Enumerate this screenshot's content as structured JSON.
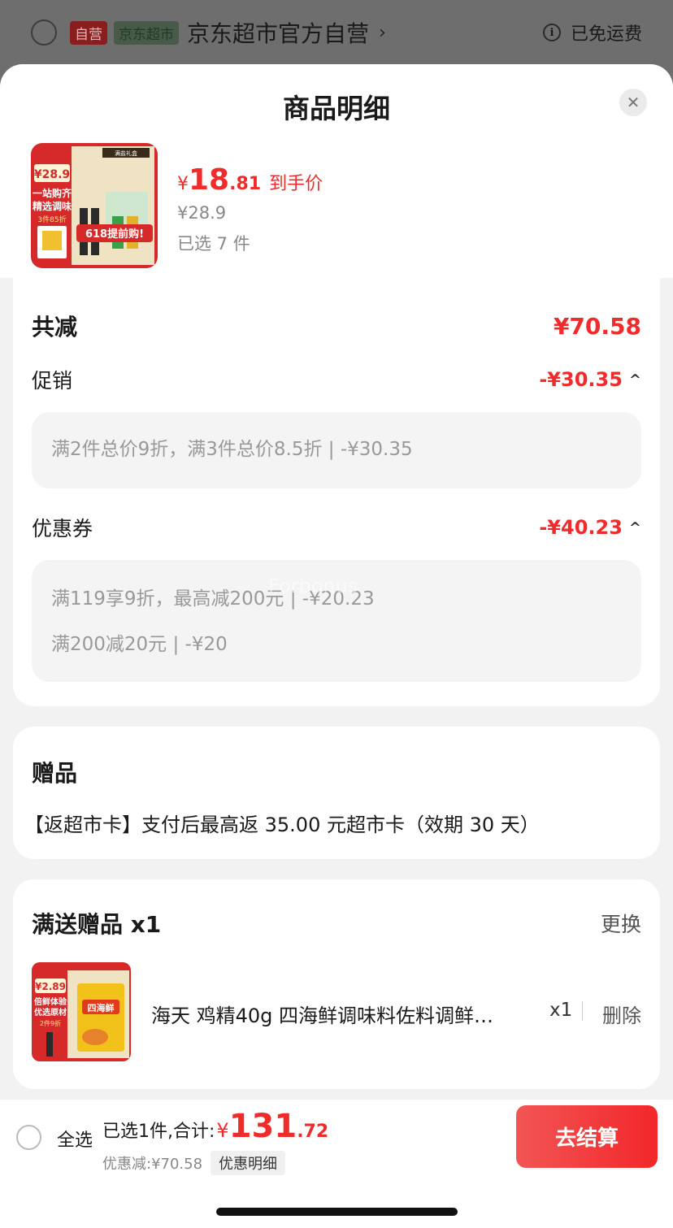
{
  "background_header": {
    "self_badge": "自营",
    "market_badge": "京东超市",
    "shop_name": "京东超市官方自营",
    "chevron": "›",
    "info_icon": "i",
    "shipping": "已免运费"
  },
  "sheet": {
    "title": "商品明细",
    "close_icon": "✕"
  },
  "product": {
    "price_symbol": "¥",
    "price_integer": "18",
    "price_decimal": ".81",
    "price_tag": "到手价",
    "original_price": "¥28.9",
    "selected_count": "已选 7 件",
    "image": {
      "top_price": "¥28.9",
      "slogan_1": "一站购齐",
      "slogan_2": "精选调味",
      "promo": "3件85折",
      "banner": "618提前购!",
      "corner_tag": "满盐礼盒"
    }
  },
  "discount": {
    "total_label": "共减",
    "total_value": "¥70.58",
    "promotion_label": "促销",
    "promotion_value": "-¥30.35",
    "promotion_details": [
      "满2件总价9折，满3件总价8.5折 | -¥30.35"
    ],
    "coupon_label": "优惠券",
    "coupon_value": "-¥40.23",
    "coupon_details": [
      "满119享9折，最高减200元 | -¥20.23",
      "满200减20元 | -¥20"
    ],
    "chevron_up": "^"
  },
  "gift": {
    "title": "赠品",
    "description": "【返超市卡】支付后最高返 35.00 元超市卡（效期 30 天）"
  },
  "full_gift": {
    "title": "满送赠品 x1",
    "change": "更换",
    "item_name": "海天 鸡精40g 四海鲜调味料佐料调鲜…",
    "item_qty": "x1",
    "delete": "删除",
    "image": {
      "top_price": "¥2.89",
      "slogan_1": "倍鲜体验",
      "slogan_2": "优选原材",
      "promo": "2件9折",
      "pack_text": "四海鲜"
    }
  },
  "bottom_bar": {
    "select_all": "全选",
    "summary_text": "已选1件,合计:",
    "sum_symbol": "¥",
    "sum_integer": "131",
    "sum_decimal": ".72",
    "saving": "优惠减:¥70.58",
    "saving_detail": "优惠明细",
    "checkout": "去结算"
  },
  "watermark": "Forbonus",
  "colors": {
    "accent_red": "#f02b2b",
    "checkout_gradient_start": "#f25555",
    "checkout_gradient_end": "#f2272a",
    "muted_text": "#888888"
  }
}
